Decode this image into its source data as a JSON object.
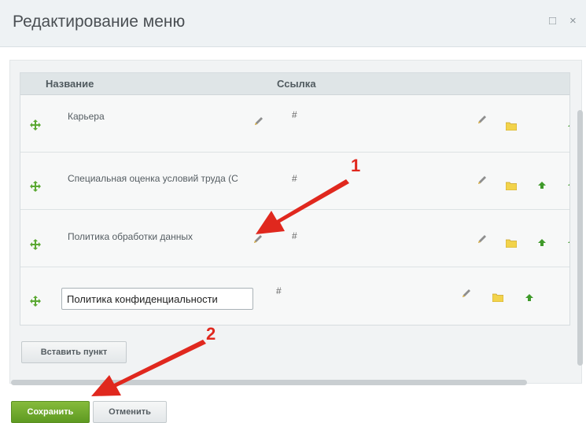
{
  "dialog": {
    "title": "Редактирование меню",
    "maximize_icon": "□",
    "close_icon": "×"
  },
  "table": {
    "headers": {
      "name": "Название",
      "link": "Ссылка"
    },
    "rows": [
      {
        "label": "Карьера",
        "link": "#"
      },
      {
        "label": "Специальная оценка условий труда (С",
        "link": "#"
      },
      {
        "label": "Политика обработки данных",
        "link": "#"
      },
      {
        "value": "Политика конфиденциальности",
        "link": "#"
      }
    ]
  },
  "buttons": {
    "insert": "Вставить пункт",
    "save": "Сохранить",
    "cancel": "Отменить"
  },
  "annotations": {
    "one": "1",
    "two": "2"
  },
  "colors": {
    "accent_green": "#6aa82a",
    "annotation_red": "#e0281e",
    "folder_yellow": "#f2d34b"
  }
}
